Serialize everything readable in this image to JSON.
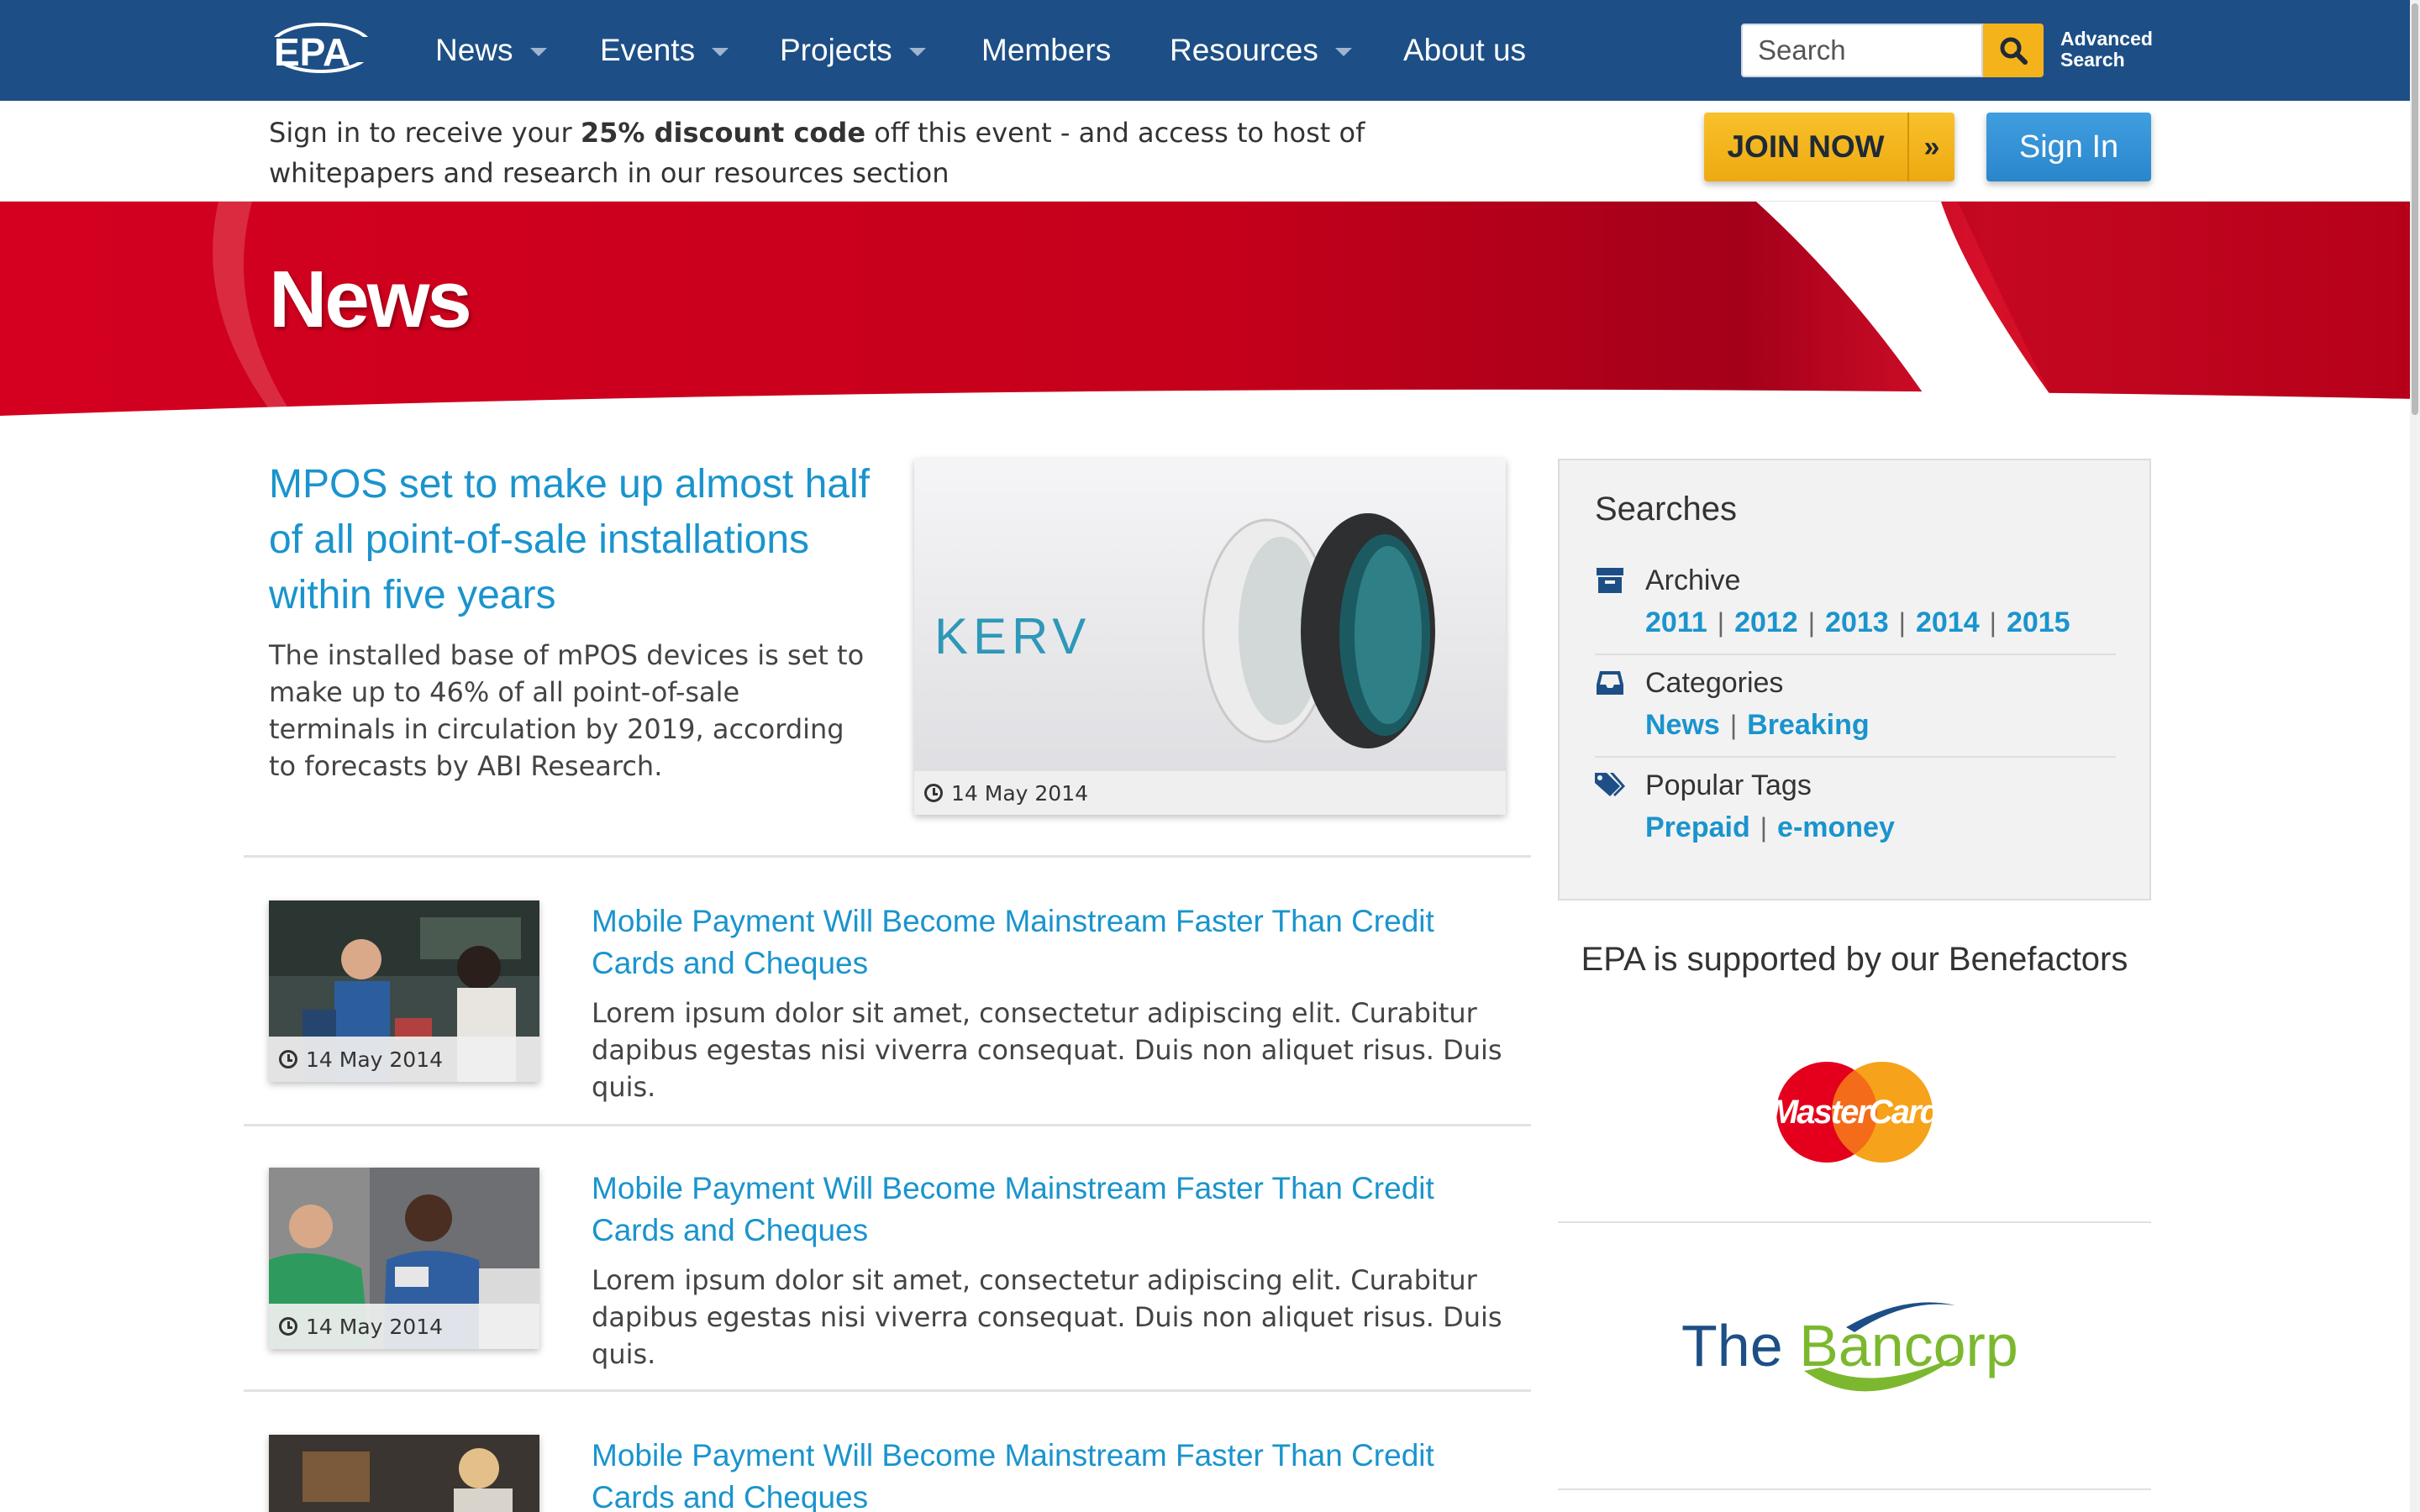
{
  "nav": {
    "logo_text": "EPA",
    "items": [
      {
        "label": "News",
        "dropdown": true
      },
      {
        "label": "Events",
        "dropdown": true
      },
      {
        "label": "Projects",
        "dropdown": true
      },
      {
        "label": "Members",
        "dropdown": false
      },
      {
        "label": "Resources",
        "dropdown": true
      },
      {
        "label": "About us",
        "dropdown": false
      }
    ],
    "search_placeholder": "Search",
    "advanced_search_line1": "Advanced",
    "advanced_search_line2": "Search"
  },
  "signin_strip": {
    "text_before": "Sign in to receive your ",
    "text_bold": "25% discount code",
    "text_after": " off this event - and access to host of whitepapers and research in our resources section",
    "join_label": "JOIN NOW",
    "join_arrow": "»",
    "signin_label": "Sign In"
  },
  "hero": {
    "title": "News"
  },
  "featured": {
    "title": "MPOS set to make up almost half of all point-of-sale installations within five years",
    "body": "The installed base of mPOS devices is set to make up to 46% of all point-of-sale terminals in circulation by 2019, according to forecasts by ABI Research.",
    "date": "14 May 2014",
    "image_brand": "KERV"
  },
  "articles": [
    {
      "title": "Mobile Payment Will Become Mainstream Faster Than Credit Cards and Cheques",
      "body": "Lorem ipsum dolor sit amet, consectetur adipiscing elit. Curabitur dapibus egestas nisi viverra consequat. Duis non aliquet risus. Duis quis.",
      "date": "14 May 2014"
    },
    {
      "title": "Mobile Payment Will Become Mainstream Faster Than Credit Cards and Cheques",
      "body": "Lorem ipsum dolor sit amet, consectetur adipiscing elit. Curabitur dapibus egestas nisi viverra consequat. Duis non aliquet risus. Duis quis.",
      "date": "14 May 2014"
    },
    {
      "title": "Mobile Payment Will Become Mainstream Faster Than Credit Cards and Cheques",
      "body": "",
      "date": ""
    }
  ],
  "sidebar": {
    "searches_title": "Searches",
    "archive": {
      "label": "Archive",
      "years": [
        "2011",
        "2012",
        "2013",
        "2014",
        "2015"
      ]
    },
    "categories": {
      "label": "Categories",
      "items": [
        "News",
        "Breaking"
      ]
    },
    "tags": {
      "label": "Popular Tags",
      "items": [
        "Prepaid",
        "e-money"
      ]
    },
    "benefactors_title": "EPA is supported by our Benefactors",
    "benefactors": [
      {
        "name": "MasterCard"
      },
      {
        "name": "The Bancorp",
        "part1": "The ",
        "part2": "Bancorp"
      }
    ]
  },
  "colors": {
    "nav_bg": "#1d4f86",
    "link_blue": "#1a94cd",
    "hero_red": "#c8001e",
    "join_yellow": "#f5b31b",
    "signin_blue": "#2a86cb"
  }
}
